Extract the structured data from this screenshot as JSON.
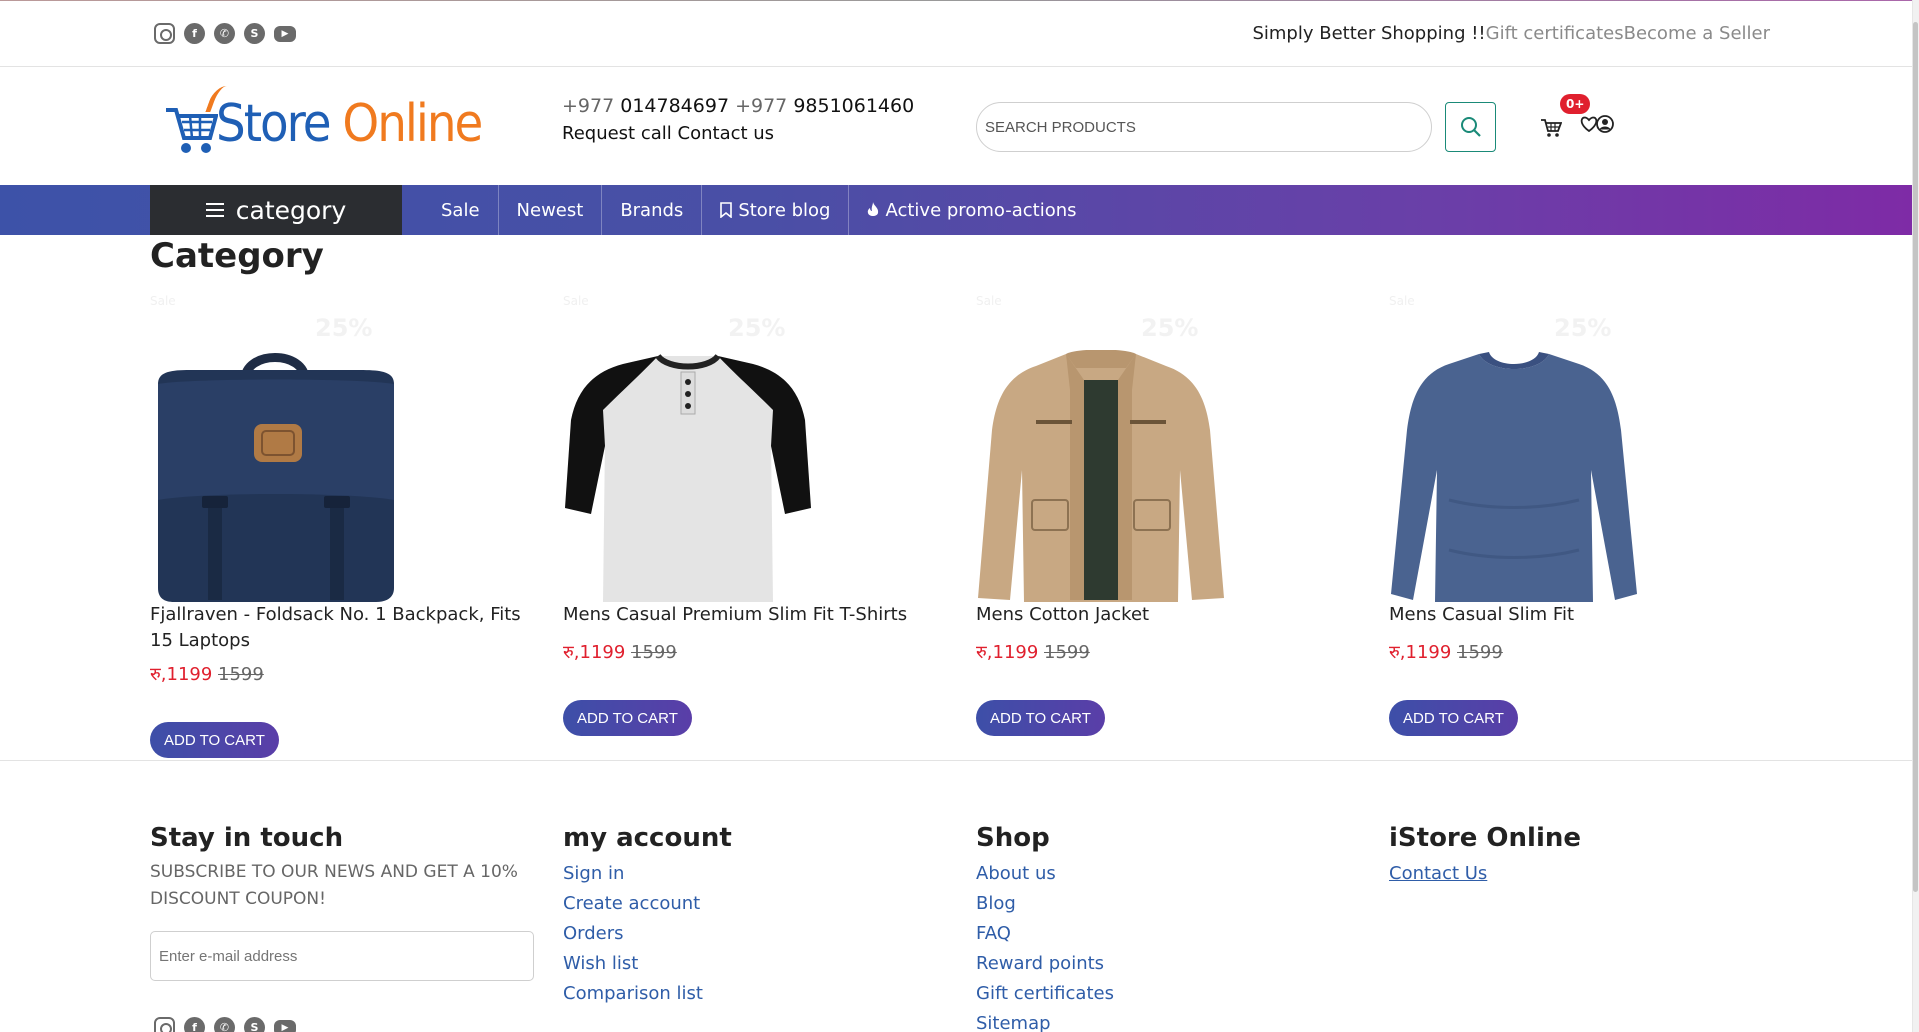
{
  "topbar": {
    "social_icons": [
      "instagram-icon",
      "facebook-icon",
      "whatsapp-icon",
      "skype-icon",
      "youtube-icon"
    ],
    "tagline": "Simply Better Shopping !!",
    "gift_link": "Gift certificates",
    "seller_link": "Become a Seller"
  },
  "header": {
    "logo_text_1": "iStore",
    "logo_text_2": "Online",
    "phone_prefix_1": "+977",
    "phone_1": "014784697",
    "phone_prefix_2": "+977",
    "phone_2": "9851061460",
    "request_call": "Request call",
    "contact_us": "Contact us",
    "search_placeholder": "SEARCH PRODUCTS",
    "cart_badge": "0+"
  },
  "nav": {
    "category_label": "category",
    "items": [
      "Sale",
      "Newest",
      "Brands",
      "Store blog",
      "Active promo-actions"
    ]
  },
  "page_title": "Category",
  "products": [
    {
      "name": "Fjallraven - Foldsack No. 1 Backpack, Fits 15 Laptops",
      "price": "रु,1199",
      "old_price": "1599",
      "button": "ADD TO CART",
      "ghost_label": "Sale",
      "ghost_pct": "25%"
    },
    {
      "name": "Mens Casual Premium Slim Fit T-Shirts",
      "price": "रु,1199",
      "old_price": "1599",
      "button": "ADD TO CART",
      "ghost_label": "Sale",
      "ghost_pct": "25%"
    },
    {
      "name": "Mens Cotton Jacket",
      "price": "रु,1199",
      "old_price": "1599",
      "button": "ADD TO CART",
      "ghost_label": "Sale",
      "ghost_pct": "25%"
    },
    {
      "name": "Mens Casual Slim Fit",
      "price": "रु,1199",
      "old_price": "1599",
      "button": "ADD TO CART",
      "ghost_label": "Sale",
      "ghost_pct": "25%"
    }
  ],
  "footer": {
    "stay_title": "Stay in touch",
    "subscribe_text": "SUBSCRIBE TO OUR NEWS AND GET A 10% DISCOUNT COUPON!",
    "email_placeholder": "Enter e-mail address",
    "account_title": "my account",
    "account_links": [
      "Sign in",
      "Create account",
      "Orders",
      "Wish list",
      "Comparison list"
    ],
    "shop_title": "Shop",
    "shop_links": [
      "About us",
      "Blog",
      "FAQ",
      "Reward points",
      "Gift certificates",
      "Sitemap"
    ],
    "store_title": "iStore Online",
    "store_links": [
      "Contact Us"
    ]
  },
  "colors": {
    "nav_gradient_start": "#3d52a8",
    "nav_gradient_end": "#7e2ba6",
    "price_red": "#e0202e",
    "link_blue": "#2f5da8",
    "search_green": "#1a8a78",
    "category_dark": "#2b2d31"
  }
}
